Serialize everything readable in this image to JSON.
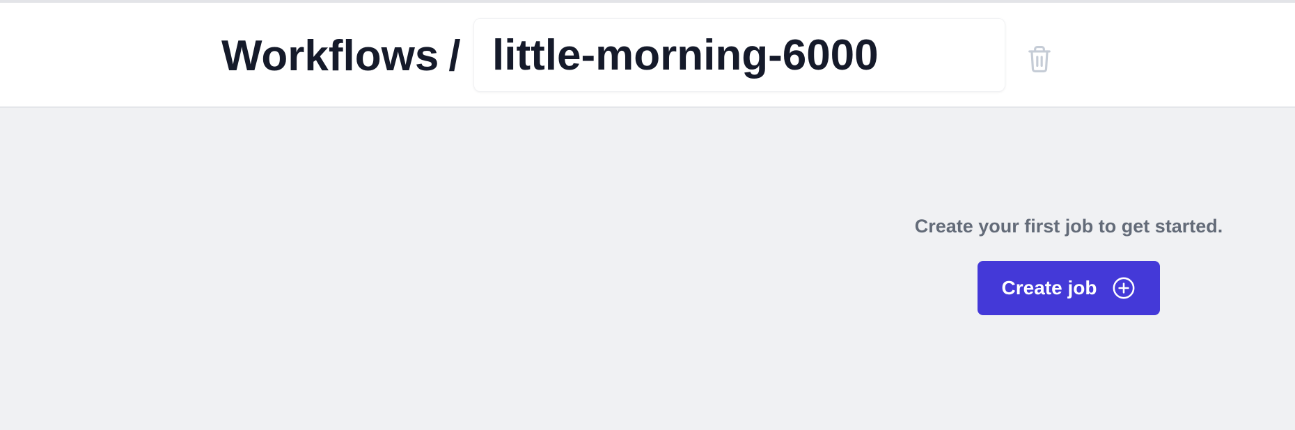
{
  "header": {
    "breadcrumb_root": "Workflows",
    "breadcrumb_separator": "/",
    "workflow_name": "little-morning-6000",
    "delete_icon": "trash-icon"
  },
  "main": {
    "empty_message": "Create your first job to get started.",
    "create_job_label": "Create job",
    "create_job_icon": "plus-circle-icon"
  },
  "colors": {
    "primary_button": "#4439d8",
    "page_background": "#f0f1f3",
    "header_background": "#ffffff",
    "title_text": "#151a2a",
    "muted_text": "#636b78",
    "disabled_icon": "#c5ccd6"
  }
}
